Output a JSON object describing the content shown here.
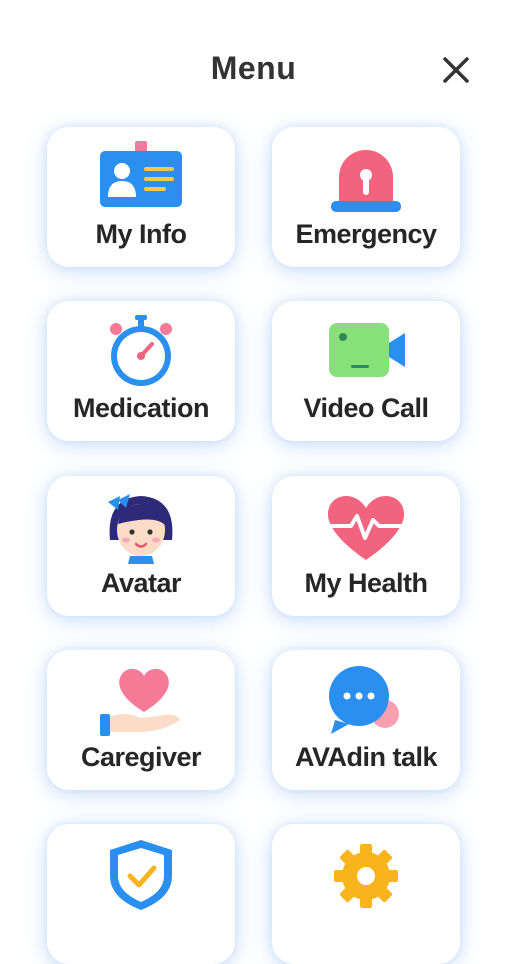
{
  "header": {
    "title": "Menu",
    "close_icon": "close-icon"
  },
  "menu": {
    "items": [
      {
        "label": "My Info",
        "icon": "id-card-icon"
      },
      {
        "label": "Emergency",
        "icon": "siren-icon"
      },
      {
        "label": "Medication",
        "icon": "timer-icon"
      },
      {
        "label": "Video Call",
        "icon": "video-camera-icon"
      },
      {
        "label": "Avatar",
        "icon": "avatar-girl-icon"
      },
      {
        "label": "My Health",
        "icon": "heartbeat-icon"
      },
      {
        "label": "Caregiver",
        "icon": "hand-heart-icon"
      },
      {
        "label": "AVAdin talk",
        "icon": "chat-bubble-icon"
      },
      {
        "label": "",
        "icon": "shield-check-icon"
      },
      {
        "label": "",
        "icon": "gear-icon"
      }
    ]
  },
  "colors": {
    "accent_blue": "#2B8FF0",
    "accent_pink": "#F2647E",
    "accent_green": "#88E07A",
    "accent_yellow": "#F9B31C",
    "text": "#262626"
  }
}
